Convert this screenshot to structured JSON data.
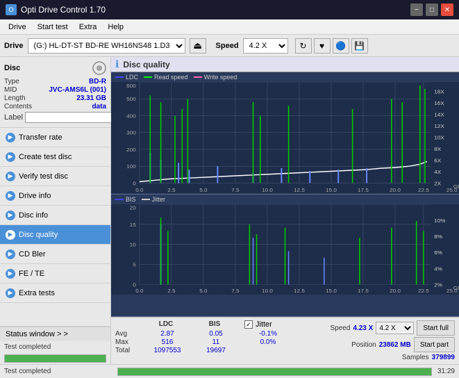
{
  "titlebar": {
    "title": "Opti Drive Control 1.70",
    "icon": "O",
    "min_label": "−",
    "max_label": "□",
    "close_label": "✕"
  },
  "menubar": {
    "items": [
      "Drive",
      "Start test",
      "Extra",
      "Help"
    ]
  },
  "drivebar": {
    "drive_label": "Drive",
    "drive_value": "(G:)  HL-DT-ST BD-RE  WH16NS48 1.D3",
    "speed_label": "Speed",
    "speed_value": "4.2 X"
  },
  "disc": {
    "title": "Disc",
    "type_label": "Type",
    "type_value": "BD-R",
    "mid_label": "MID",
    "mid_value": "JVC-AMS6L (001)",
    "length_label": "Length",
    "length_value": "23.31 GB",
    "contents_label": "Contents",
    "contents_value": "data",
    "label_label": "Label",
    "label_placeholder": ""
  },
  "nav": {
    "items": [
      {
        "id": "transfer-rate",
        "label": "Transfer rate",
        "active": false
      },
      {
        "id": "create-test-disc",
        "label": "Create test disc",
        "active": false
      },
      {
        "id": "verify-test-disc",
        "label": "Verify test disc",
        "active": false
      },
      {
        "id": "drive-info",
        "label": "Drive info",
        "active": false
      },
      {
        "id": "disc-info",
        "label": "Disc info",
        "active": false
      },
      {
        "id": "disc-quality",
        "label": "Disc quality",
        "active": true
      },
      {
        "id": "cd-bler",
        "label": "CD Bler",
        "active": false
      },
      {
        "id": "fe-te",
        "label": "FE / TE",
        "active": false
      },
      {
        "id": "extra-tests",
        "label": "Extra tests",
        "active": false
      }
    ]
  },
  "status_window": {
    "label": "Status window > >"
  },
  "status": {
    "text": "Test completed",
    "progress": 100,
    "time": "31:29"
  },
  "quality": {
    "title": "Disc quality",
    "legend1": {
      "ldc": "LDC",
      "read": "Read speed",
      "write": "Write speed"
    },
    "legend2": {
      "bis": "BIS",
      "jitter": "Jitter"
    },
    "chart1_y_max": 600,
    "chart1_y_right_max": 18,
    "chart2_y_max": 20,
    "chart2_y_right_max": 10,
    "x_max": 25,
    "x_labels": [
      "0.0",
      "2.5",
      "5.0",
      "7.5",
      "10.0",
      "12.5",
      "15.0",
      "17.5",
      "20.0",
      "22.5",
      "25.0"
    ],
    "y1_labels": [
      "0",
      "100",
      "200",
      "300",
      "400",
      "500",
      "600"
    ],
    "y1_right_labels": [
      "2X",
      "4X",
      "6X",
      "8X",
      "10X",
      "12X",
      "14X",
      "16X",
      "18X"
    ],
    "y2_labels": [
      "0",
      "5",
      "10",
      "15",
      "20"
    ],
    "y2_right_labels": [
      "2%",
      "4%",
      "6%",
      "8%",
      "10%"
    ]
  },
  "stats": {
    "col_ldc": "LDC",
    "col_bis": "BIS",
    "col_jitter": "Jitter",
    "row_avg": "Avg",
    "row_max": "Max",
    "row_total": "Total",
    "avg_ldc": "2.87",
    "avg_bis": "0.05",
    "avg_jitter": "-0.1%",
    "max_ldc": "516",
    "max_bis": "11",
    "max_jitter": "0.0%",
    "total_ldc": "1097553",
    "total_bis": "19697",
    "jitter_checked": true,
    "speed_label": "Speed",
    "speed_value": "4.23 X",
    "speed_select": "4.2 X",
    "position_label": "Position",
    "position_value": "23862 MB",
    "samples_label": "Samples",
    "samples_value": "379899",
    "start_full_label": "Start full",
    "start_part_label": "Start part"
  }
}
